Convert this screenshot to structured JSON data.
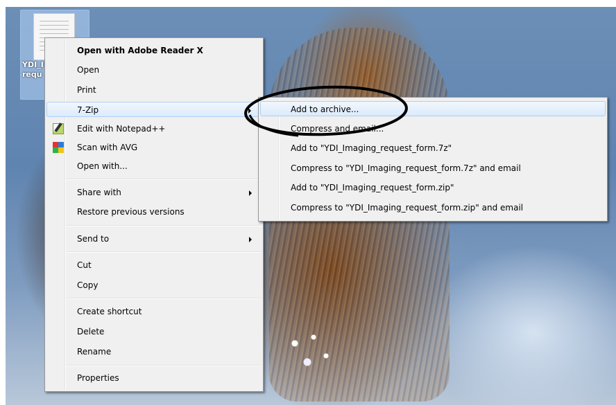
{
  "desktop_icon": {
    "label_line1": "YDI_I",
    "label_line2": "requ"
  },
  "context_menu": {
    "items": [
      {
        "label": "Open with Adobe Reader X"
      },
      {
        "label": "Open"
      },
      {
        "label": "Print"
      },
      {
        "label": "7-Zip"
      },
      {
        "label": "Edit with Notepad++"
      },
      {
        "label": "Scan with AVG"
      },
      {
        "label": "Open with..."
      },
      {
        "label": "Share with"
      },
      {
        "label": "Restore previous versions"
      },
      {
        "label": "Send to"
      },
      {
        "label": "Cut"
      },
      {
        "label": "Copy"
      },
      {
        "label": "Create shortcut"
      },
      {
        "label": "Delete"
      },
      {
        "label": "Rename"
      },
      {
        "label": "Properties"
      }
    ]
  },
  "zip_submenu": {
    "items": [
      {
        "label": "Add to archive..."
      },
      {
        "label": "Compress and email..."
      },
      {
        "label": "Add to \"YDI_Imaging_request_form.7z\""
      },
      {
        "label": "Compress to \"YDI_Imaging_request_form.7z\" and email"
      },
      {
        "label": "Add to \"YDI_Imaging_request_form.zip\""
      },
      {
        "label": "Compress to \"YDI_Imaging_request_form.zip\" and email"
      }
    ]
  },
  "icons": {
    "file": "pdf-document-icon",
    "notepad": "notepad-plus-plus-icon",
    "avg": "avg-shield-icon",
    "submenu_arrow": "chevron-right-icon"
  },
  "colors": {
    "highlight_border": "#aecff7",
    "menu_bg": "#f0f0f0",
    "annotation_ink": "#000000"
  }
}
